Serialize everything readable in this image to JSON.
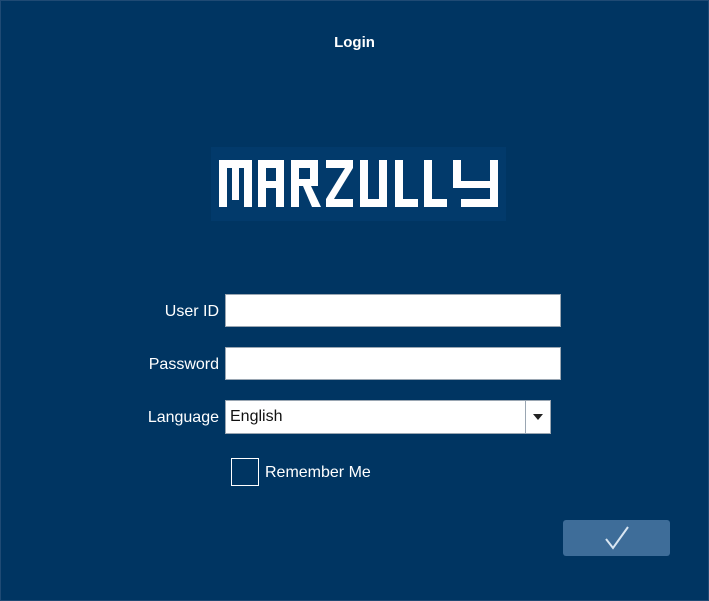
{
  "window": {
    "title": "Login"
  },
  "logo": {
    "brand_text": "MARZULLY"
  },
  "form": {
    "user_id_label": "User ID",
    "user_id_value": "",
    "password_label": "Password",
    "password_value": "",
    "language_label": "Language",
    "language_selected": "English",
    "remember_label": "Remember Me",
    "remember_checked": false
  },
  "icons": {
    "dropdown": "caret-down-icon",
    "submit": "checkmark-icon"
  },
  "colors": {
    "background": "#003562",
    "submit_button": "#3e6d99",
    "logo_text": "#ffffff"
  }
}
